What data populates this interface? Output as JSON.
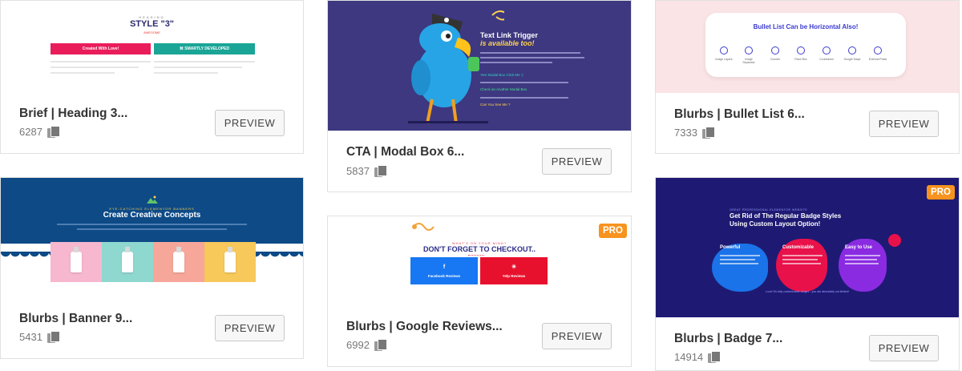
{
  "preview_label": "PREVIEW",
  "pro_label": "PRO",
  "cards": [
    {
      "title": "Brief | Heading 3...",
      "count": "6287",
      "thumb": {
        "small": "HEADING",
        "big": "STYLE \"3\"",
        "tag": "AWESOME",
        "btn_left": "Created With Love!",
        "btn_right": "⌘ SMARTLY DEVELOPED",
        "color_left": "#ea1d5b",
        "color_right": "#1aa597"
      }
    },
    {
      "title": "CTA | Modal Box 6...",
      "count": "5837",
      "thumb": {
        "heading": "Text Link Trigger",
        "heading_em": "is available too!",
        "link1": "Yes! Modal Box Click Me :)",
        "link2": "Check an Another Modal Box",
        "link3": "Can You See Me ?"
      }
    },
    {
      "title": "Blurbs | Bullet List 6...",
      "count": "7333",
      "thumb": {
        "heading": "Bullet List Can be Horizontal Also!",
        "items": [
          "Image Layers",
          "Image Separator",
          "Counter",
          "Flash Box",
          "Countdown",
          "Google Maps",
          "External Posts"
        ]
      }
    },
    {
      "title": "Blurbs | Banner 9...",
      "count": "5431",
      "thumb": {
        "sub": "EYE-CATCHING ELEMENTOR BANNERS",
        "heading": "Create Creative Concepts",
        "tile_colors": [
          "#f6b7cf",
          "#8fd8cf",
          "#f7a79a",
          "#f7c85a"
        ]
      }
    },
    {
      "title": "Blurbs | Google Reviews...",
      "count": "6992",
      "pro": true,
      "thumb": {
        "small": "WHAT'S ON YOUR MIND?",
        "heading": "DON'T FORGET TO CHECKOUT..",
        "box_left": "Facebook Reviews",
        "box_right": "Yelp Reviews",
        "icon_left": "f",
        "icon_right": "✳",
        "color_left": "#1877f2",
        "color_right": "#e8112d"
      }
    },
    {
      "title": "Blurbs | Badge 7...",
      "count": "14914",
      "pro": true,
      "thumb": {
        "sub": "GREAT PROFESSIONAL ELEMENTOR WEBSITE",
        "heading_line1": "Get Rid of The Regular Badge Styles",
        "heading_line2": "Using Custom Layout Option!",
        "col1": "Powerful",
        "col2": "Customizable",
        "col3": "Easy to Use",
        "foot": "Look! It's fully customizable widget... you are absolutely not limited!"
      }
    }
  ]
}
